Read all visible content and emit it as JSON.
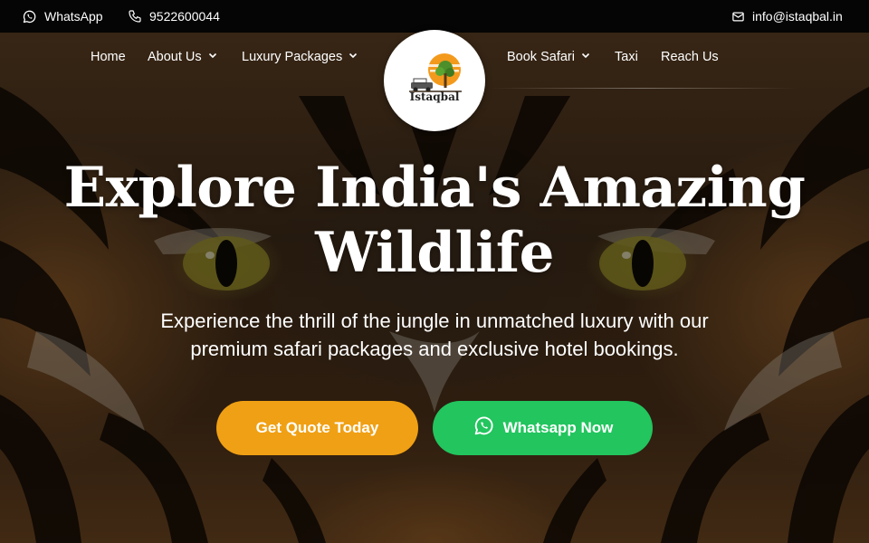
{
  "topbar": {
    "whatsapp_label": "WhatsApp",
    "phone": "9522600044",
    "email": "info@istaqbal.in"
  },
  "nav": {
    "items": [
      {
        "label": "Home",
        "dropdown": false
      },
      {
        "label": "About Us",
        "dropdown": true
      },
      {
        "label": "Luxury Packages",
        "dropdown": true
      },
      {
        "label": "Book Safari",
        "dropdown": true
      },
      {
        "label": "Taxi",
        "dropdown": false
      },
      {
        "label": "Reach Us",
        "dropdown": false
      }
    ]
  },
  "logo": {
    "brand": "Istaqbal"
  },
  "hero": {
    "title_line1": "Explore India's Amazing",
    "title_line2": "Wildlife",
    "subtitle_line1": "Experience the thrill of the jungle in unmatched luxury with our",
    "subtitle_line2": "premium safari packages and exclusive hotel bookings.",
    "cta_primary": "Get Quote Today",
    "cta_secondary": "Whatsapp Now"
  },
  "icons": {
    "whatsapp": "whatsapp-icon",
    "phone": "phone-icon",
    "mail": "mail-icon",
    "chevron": "chevron-down-icon"
  },
  "colors": {
    "topbar_bg": "#050505",
    "quote_button": "#f0a014",
    "whatsapp_button": "#22c55e",
    "text": "#ffffff"
  }
}
